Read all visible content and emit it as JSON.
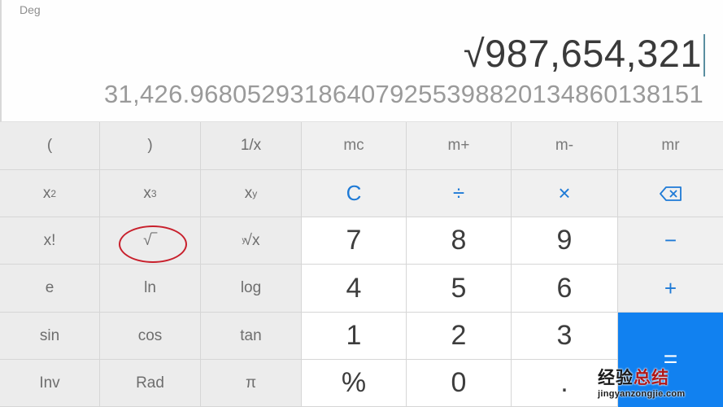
{
  "display": {
    "angle_mode": "Deg",
    "expression": "√987,654,321",
    "result": "31,426.968052931864079255398820134860138151"
  },
  "keys": {
    "row1": [
      "(",
      ")",
      "1/x",
      "mc",
      "m+",
      "m-",
      "mr"
    ],
    "row2": {
      "x_squared": {
        "base": "x",
        "sup": "2"
      },
      "x_cubed": {
        "base": "x",
        "sup": "3"
      },
      "x_power_y": {
        "base": "x",
        "sup": "y"
      },
      "clear": "C",
      "divide": "÷",
      "multiply": "×",
      "backspace_icon": "backspace-icon"
    },
    "row3": {
      "factorial": "x!",
      "square_root": "√‾",
      "nth_root": {
        "index": "y",
        "radical": "√x"
      },
      "seven": "7",
      "eight": "8",
      "nine": "9",
      "minus": "−"
    },
    "row4": [
      "e",
      "ln",
      "log",
      "4",
      "5",
      "6",
      "+"
    ],
    "row5": [
      "sin",
      "cos",
      "tan",
      "1",
      "2",
      "3"
    ],
    "row6": [
      "Inv",
      "Rad",
      "π",
      "%",
      "0",
      "."
    ],
    "equals": "="
  },
  "annotation": {
    "highlighted_key": "square_root",
    "ring_color": "#c8202c"
  },
  "watermark": {
    "line1_black": "经验",
    "line1_red": "总结",
    "line2": "jingyanzongjie.com"
  },
  "colors": {
    "accent_blue": "#1181f0",
    "operator_text": "#1e7ad6",
    "sci_key_bg": "#ececec",
    "num_key_bg": "#ffffff"
  }
}
